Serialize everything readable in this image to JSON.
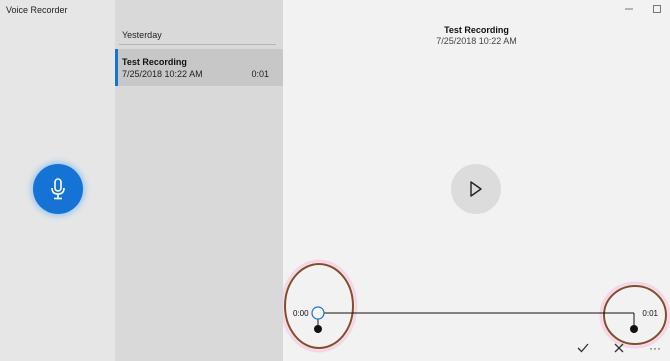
{
  "app": {
    "title": "Voice Recorder"
  },
  "list": {
    "group_header": "Yesterday",
    "items": [
      {
        "name": "Test Recording",
        "date": "7/25/2018 10:22 AM",
        "duration": "0:01"
      }
    ]
  },
  "player": {
    "title": "Test Recording",
    "date": "7/25/2018 10:22 AM",
    "start_time": "0:00",
    "end_time": "0:01"
  },
  "actions": {
    "more_label": "···"
  },
  "colors": {
    "accent": "#1673d6",
    "annotation": "#7a3a1a"
  },
  "icons": [
    "microphone-icon",
    "play-icon",
    "minimize-icon",
    "maximize-icon",
    "checkmark-icon",
    "close-icon",
    "more-icon"
  ]
}
